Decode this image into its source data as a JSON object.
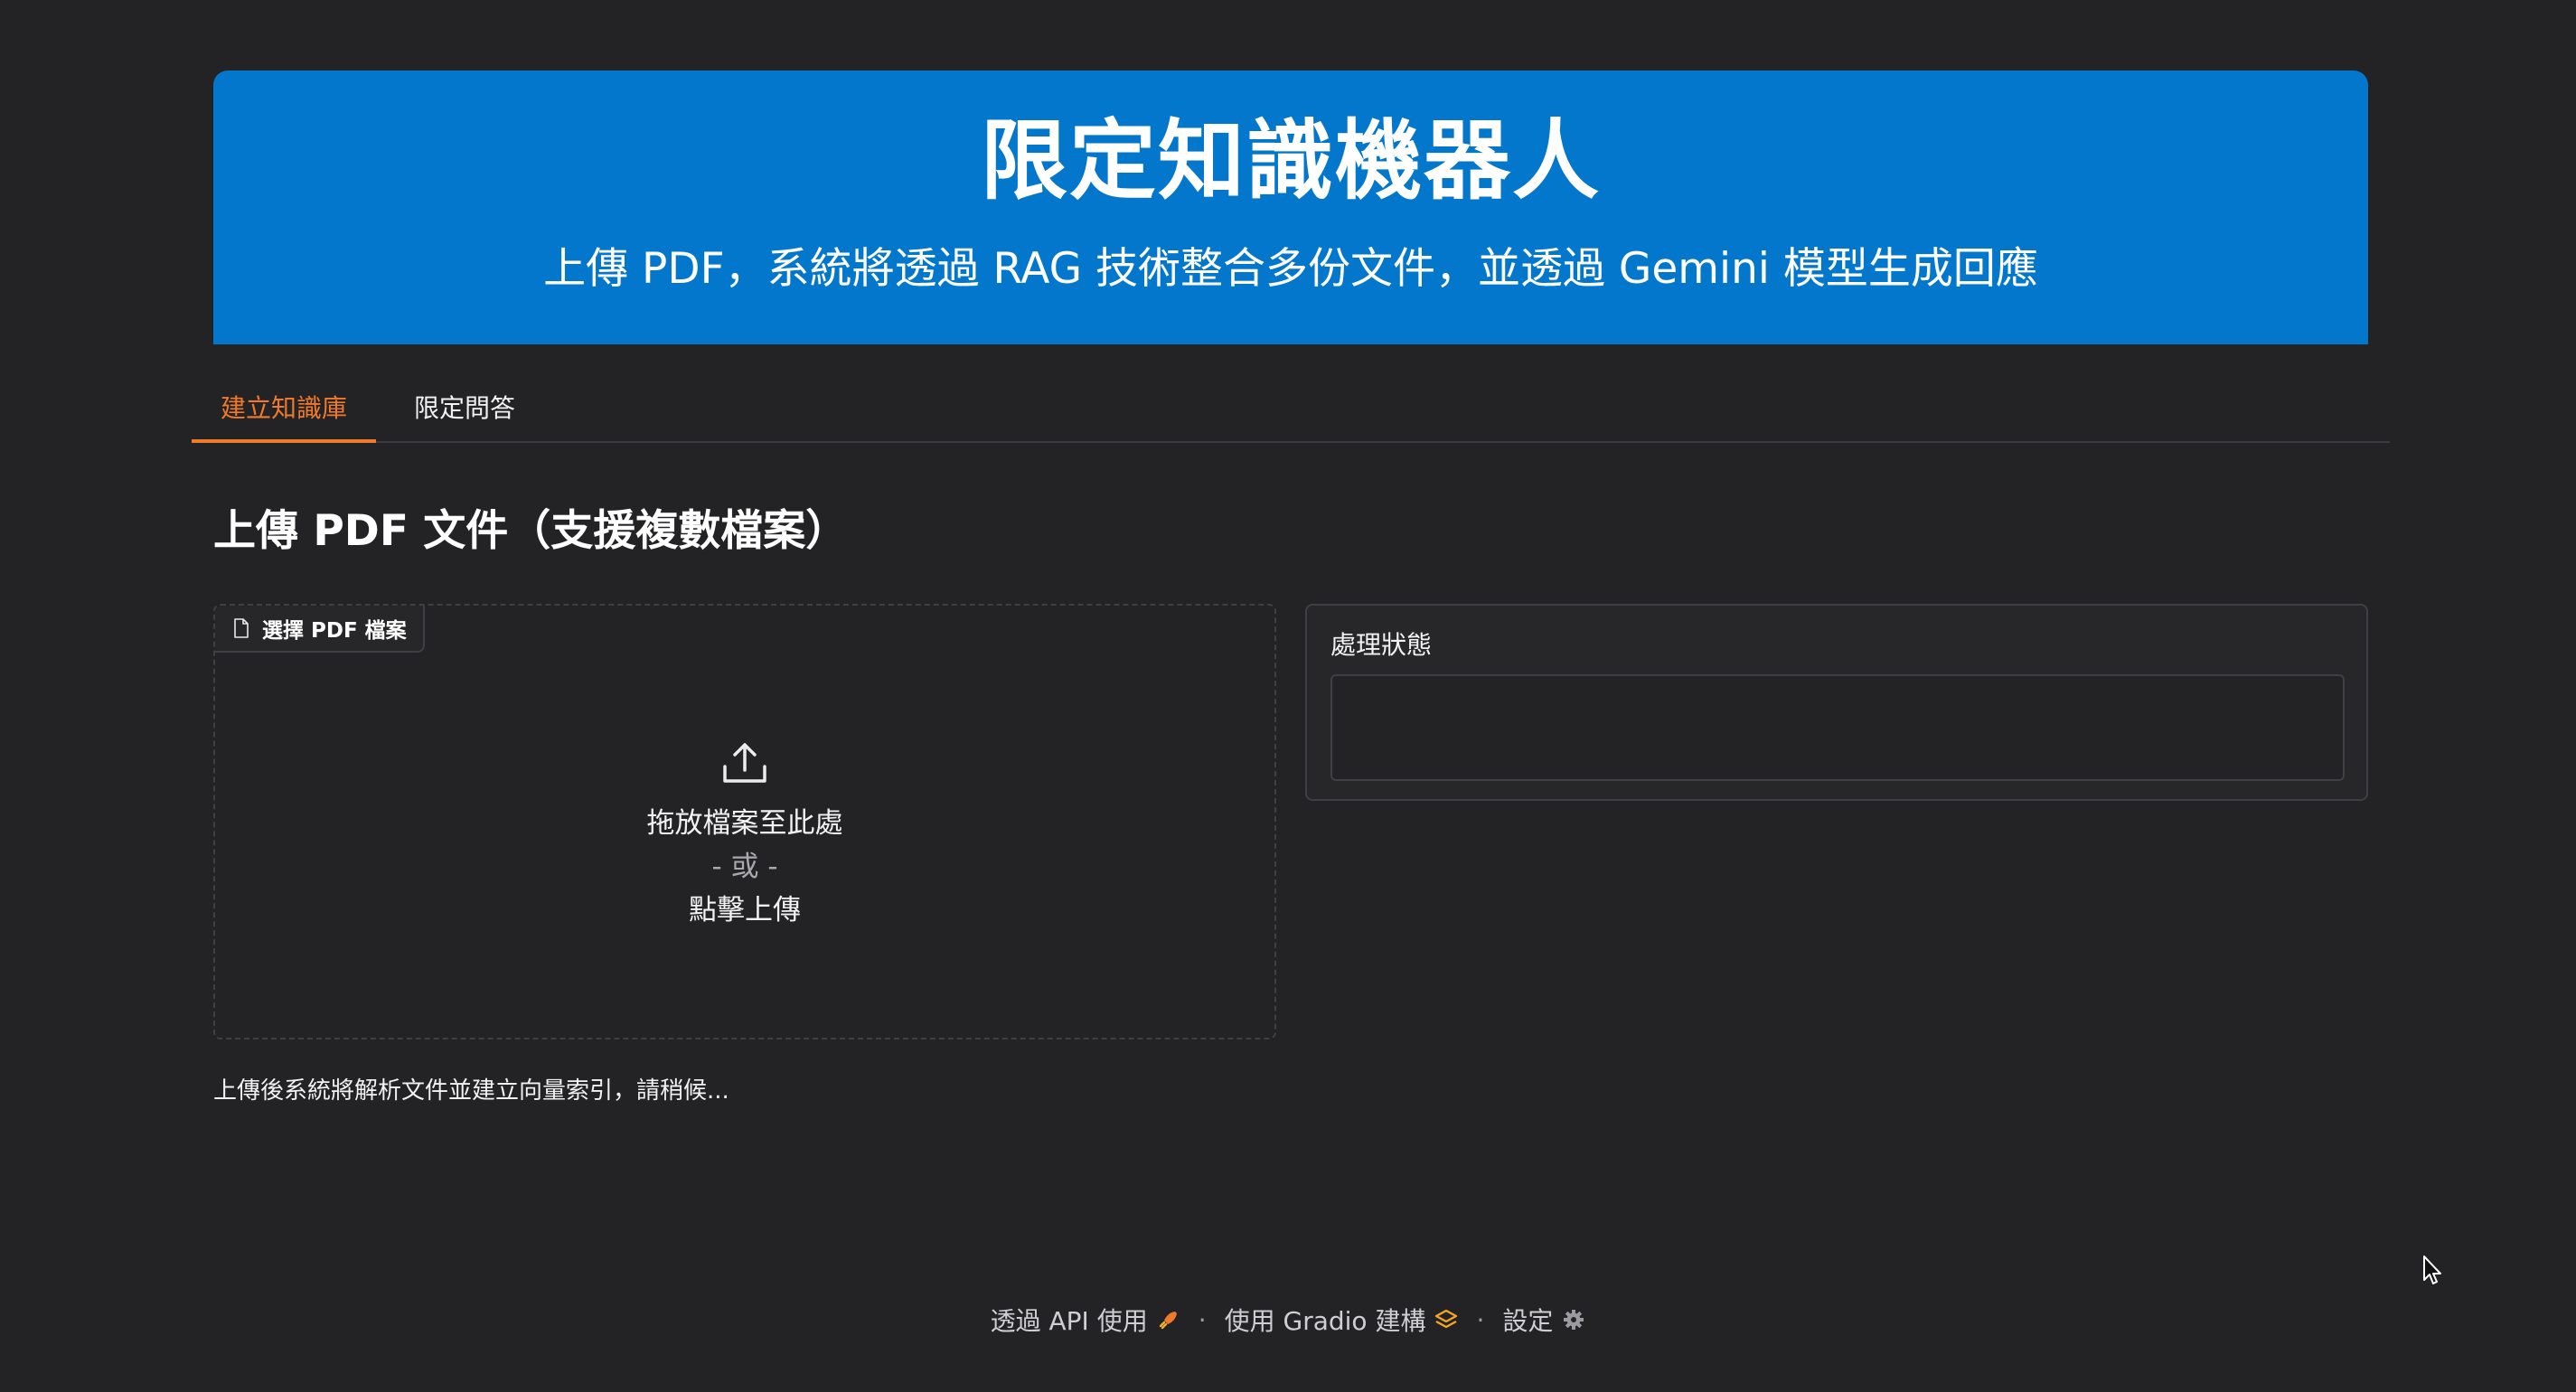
{
  "header": {
    "title": "限定知識機器人",
    "subtitle": "上傳 PDF，系統將透過 RAG 技術整合多份文件，並透過 Gemini 模型生成回應",
    "background_color": "#0377cc"
  },
  "tabs": [
    {
      "label": "建立知識庫",
      "active": true
    },
    {
      "label": "限定問答",
      "active": false
    }
  ],
  "accent_color": "#f07a2c",
  "section": {
    "title": "上傳 PDF 文件（支援複數檔案）"
  },
  "upload": {
    "label": "選擇 PDF 檔案",
    "label_icon": "file-icon",
    "upload_icon": "upload-icon",
    "drop_text": "拖放檔案至此處",
    "or_text": "- 或 -",
    "click_text": "點擊上傳",
    "hint": "上傳後系統將解析文件並建立向量索引，請稍候..."
  },
  "status": {
    "label": "處理狀態",
    "value": ""
  },
  "footer": {
    "api_label": "透過 API 使用",
    "api_icon": "rocket-icon",
    "gradio_label": "使用 Gradio 建構",
    "gradio_icon": "gradio-logo-icon",
    "settings_label": "設定",
    "settings_icon": "gear-icon",
    "separator": "·"
  }
}
